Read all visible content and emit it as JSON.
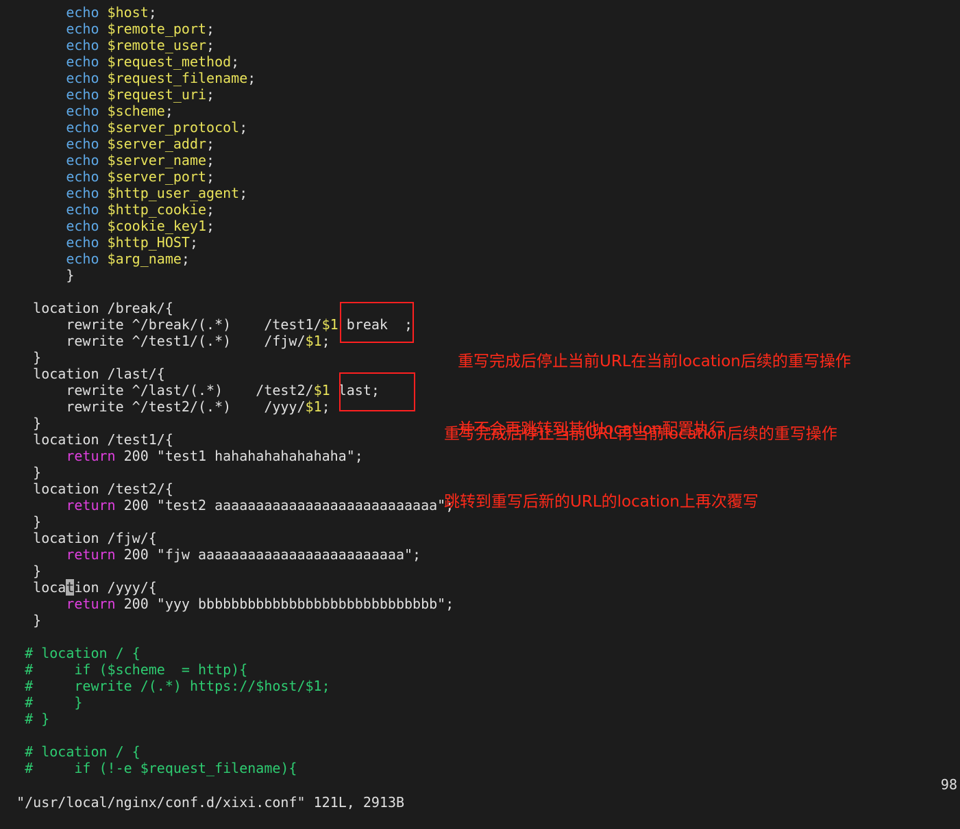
{
  "editor": {
    "lines": [
      {
        "indent": "        ",
        "kw": "echo",
        "var": "$host",
        "tail": ";"
      },
      {
        "indent": "        ",
        "kw": "echo",
        "var": "$remote_port",
        "tail": ";"
      },
      {
        "indent": "        ",
        "kw": "echo",
        "var": "$remote_user",
        "tail": ";"
      },
      {
        "indent": "        ",
        "kw": "echo",
        "var": "$request_method",
        "tail": ";"
      },
      {
        "indent": "        ",
        "kw": "echo",
        "var": "$request_filename",
        "tail": ";"
      },
      {
        "indent": "        ",
        "kw": "echo",
        "var": "$request_uri",
        "tail": ";"
      },
      {
        "indent": "        ",
        "kw": "echo",
        "var": "$scheme",
        "tail": ";"
      },
      {
        "indent": "        ",
        "kw": "echo",
        "var": "$server_protocol",
        "tail": ";"
      },
      {
        "indent": "        ",
        "kw": "echo",
        "var": "$server_addr",
        "tail": ";"
      },
      {
        "indent": "        ",
        "kw": "echo",
        "var": "$server_name",
        "tail": ";"
      },
      {
        "indent": "        ",
        "kw": "echo",
        "var": "$server_port",
        "tail": ";"
      },
      {
        "indent": "        ",
        "kw": "echo",
        "var": "$http_user_agent",
        "tail": ";"
      },
      {
        "indent": "        ",
        "kw": "echo",
        "var": "$http_cookie",
        "tail": ";"
      },
      {
        "indent": "        ",
        "kw": "echo",
        "var": "$cookie_key1",
        "tail": ";"
      },
      {
        "indent": "        ",
        "kw": "echo",
        "var": "$http_HOST",
        "tail": ";"
      },
      {
        "indent": "        ",
        "kw": "echo",
        "var": "$arg_name",
        "tail": ";"
      },
      {
        "text": "        }"
      },
      {
        "text": ""
      },
      {
        "text": "    location /break/{"
      },
      {
        "text": "        rewrite ^/break/(.*)    /test1/",
        "var": "$1",
        "tail": " break  ;"
      },
      {
        "text": "        rewrite ^/test1/(.*)    /fjw/",
        "var": "$1",
        "tail": ";"
      },
      {
        "text": "    }"
      },
      {
        "text": "    location /last/{"
      },
      {
        "text": "        rewrite ^/last/(.*)    /test2/",
        "var": "$1",
        "tail": " last;"
      },
      {
        "text": "        rewrite ^/test2/(.*)    /yyy/",
        "var": "$1",
        "tail": ";"
      },
      {
        "text": "    }"
      },
      {
        "text": "    location /test1/{"
      },
      {
        "indent": "        ",
        "ret": "return",
        "tail": " 200 \"test1 hahahahahahahaha\";"
      },
      {
        "text": "    }"
      },
      {
        "text": "    location /test2/{"
      },
      {
        "indent": "        ",
        "ret": "return",
        "tail": " 200 \"test2 aaaaaaaaaaaaaaaaaaaaaaaaaaa\";"
      },
      {
        "text": "    }"
      },
      {
        "text": "    location /fjw/{"
      },
      {
        "indent": "        ",
        "ret": "return",
        "tail": " 200 \"fjw aaaaaaaaaaaaaaaaaaaaaaaaa\";"
      },
      {
        "text": "    }"
      },
      {
        "cursorline": true,
        "pre": "    loca",
        "cur": "t",
        "post": "ion /yyy/{"
      },
      {
        "indent": "        ",
        "ret": "return",
        "tail": " 200 \"yyy bbbbbbbbbbbbbbbbbbbbbbbbbbbbb\";"
      },
      {
        "text": "    }"
      },
      {
        "text": ""
      },
      {
        "comment": "   # location / {"
      },
      {
        "comment": "   #     if ($scheme  = http){"
      },
      {
        "comment": "   #     rewrite /(.*) https://$host/$1;"
      },
      {
        "comment": "   #     }"
      },
      {
        "comment": "   # }"
      },
      {
        "text": ""
      },
      {
        "comment": "   # location / {"
      },
      {
        "comment": "   #     if (!-e $request_filename){"
      }
    ]
  },
  "status": {
    "file": "\"/usr/local/nginx/conf.d/xixi.conf\" 121L, 2913B",
    "position": "98"
  },
  "annotations": {
    "break_note_line1": "重写完成后停止当前URL在当前location后续的重写操作",
    "break_note_line2": "并不会再跳转到其他location配置执行",
    "last_note_line1": "重写完成后停止当前URL再当前location后续的重写操作",
    "last_note_line2": "跳转到重写后新的URL的location上再次覆写"
  },
  "colors": {
    "background": "#1c1c1c",
    "keyword": "#5ea8e6",
    "variable": "#e9e35a",
    "return": "#e040e0",
    "comment": "#2ecc71",
    "annotation": "#ff2a1a"
  }
}
